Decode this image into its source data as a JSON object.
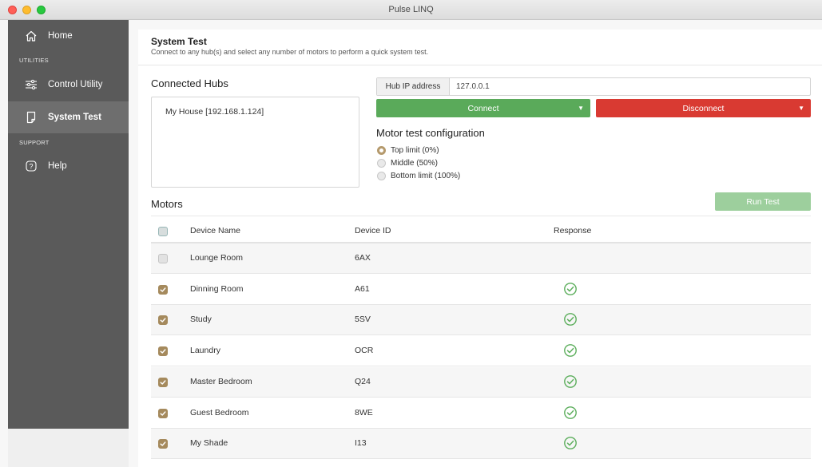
{
  "window": {
    "title": "Pulse LINQ"
  },
  "sidebar": {
    "home": "Home",
    "section_utilities": "UTILITIES",
    "control_utility": "Control Utility",
    "system_test": "System Test",
    "section_support": "SUPPORT",
    "help": "Help"
  },
  "page": {
    "title": "System Test",
    "subtitle": "Connect to any hub(s) and select any number of motors to perform a quick system test."
  },
  "hubs": {
    "title": "Connected Hubs",
    "items": [
      "My House [192.168.1.124]"
    ]
  },
  "connection": {
    "ip_label": "Hub IP address",
    "ip_value": "127.0.0.1",
    "connect_label": "Connect",
    "disconnect_label": "Disconnect"
  },
  "motor_config": {
    "title": "Motor test configuration",
    "options": [
      "Top limit (0%)",
      "Middle (50%)",
      "Bottom limit (100%)"
    ],
    "selected": "Top limit (0%)"
  },
  "motors": {
    "title": "Motors",
    "run_label": "Run Test",
    "columns": [
      "Device Name",
      "Device ID",
      "Response"
    ],
    "rows": [
      {
        "name": "Lounge Room",
        "id": "6AX",
        "checked": false,
        "response": ""
      },
      {
        "name": "Dinning Room",
        "id": "A61",
        "checked": true,
        "response": "ok"
      },
      {
        "name": "Study",
        "id": "5SV",
        "checked": true,
        "response": "ok"
      },
      {
        "name": "Laundry",
        "id": "OCR",
        "checked": true,
        "response": "ok"
      },
      {
        "name": "Master Bedroom",
        "id": "Q24",
        "checked": true,
        "response": "ok"
      },
      {
        "name": "Guest Bedroom",
        "id": "8WE",
        "checked": true,
        "response": "ok"
      },
      {
        "name": "My Shade",
        "id": "I13",
        "checked": true,
        "response": "ok"
      }
    ]
  },
  "colors": {
    "connect": "#5aaa5a",
    "disconnect": "#d93a32",
    "run_test": "#9dcf9d",
    "accent": "#a58a5d",
    "sidebar": "#5a5a5a",
    "response_ok": "#5cae5c"
  },
  "icons": {
    "home": "home-icon",
    "control_utility": "sliders-icon",
    "system_test": "test-doc-icon",
    "help": "question-icon",
    "response_ok": "check-circle-icon"
  }
}
